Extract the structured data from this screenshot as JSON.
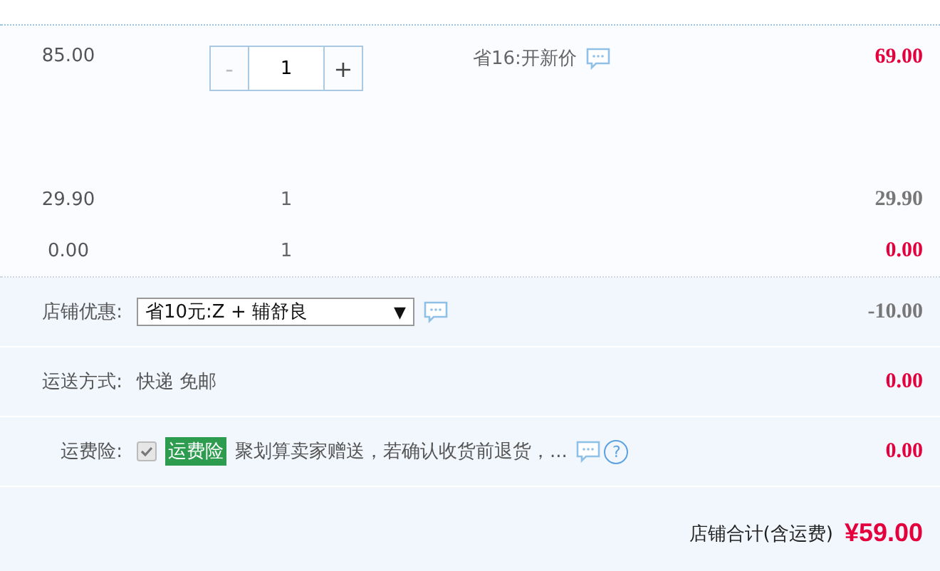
{
  "items": [
    {
      "price": "85.00",
      "quantity": {
        "kind": "stepper",
        "minus": "-",
        "value": "1",
        "plus": "+",
        "minus_disabled": true
      },
      "promo": "省16:开新价",
      "total": "69.00",
      "highlight": true
    },
    {
      "price": "29.90",
      "quantity": {
        "kind": "plain",
        "value": "1"
      },
      "total": "29.90",
      "highlight": false
    },
    {
      "price": "0.00",
      "quantity": {
        "kind": "plain",
        "value": "1"
      },
      "total": "0.00",
      "highlight": true
    }
  ],
  "store": {
    "rows": [
      {
        "kind": "select",
        "label": "店铺优惠:",
        "value": "省10元:Z + 辅舒良",
        "arrow": "▼",
        "amount": "-10.00",
        "highlight": false
      },
      {
        "kind": "text",
        "label": "运送方式:",
        "value": "快递 免邮",
        "amount": "0.00",
        "highlight": true
      },
      {
        "kind": "insurance",
        "label": "运费险:",
        "checked": true,
        "disabled": true,
        "tag": "运费险",
        "value": "聚划算卖家赠送，若确认收货前退货，...",
        "help": "?",
        "amount": "0.00",
        "highlight": true
      }
    ],
    "total_label": "店铺合计(含运费)",
    "total": "¥59.00"
  }
}
